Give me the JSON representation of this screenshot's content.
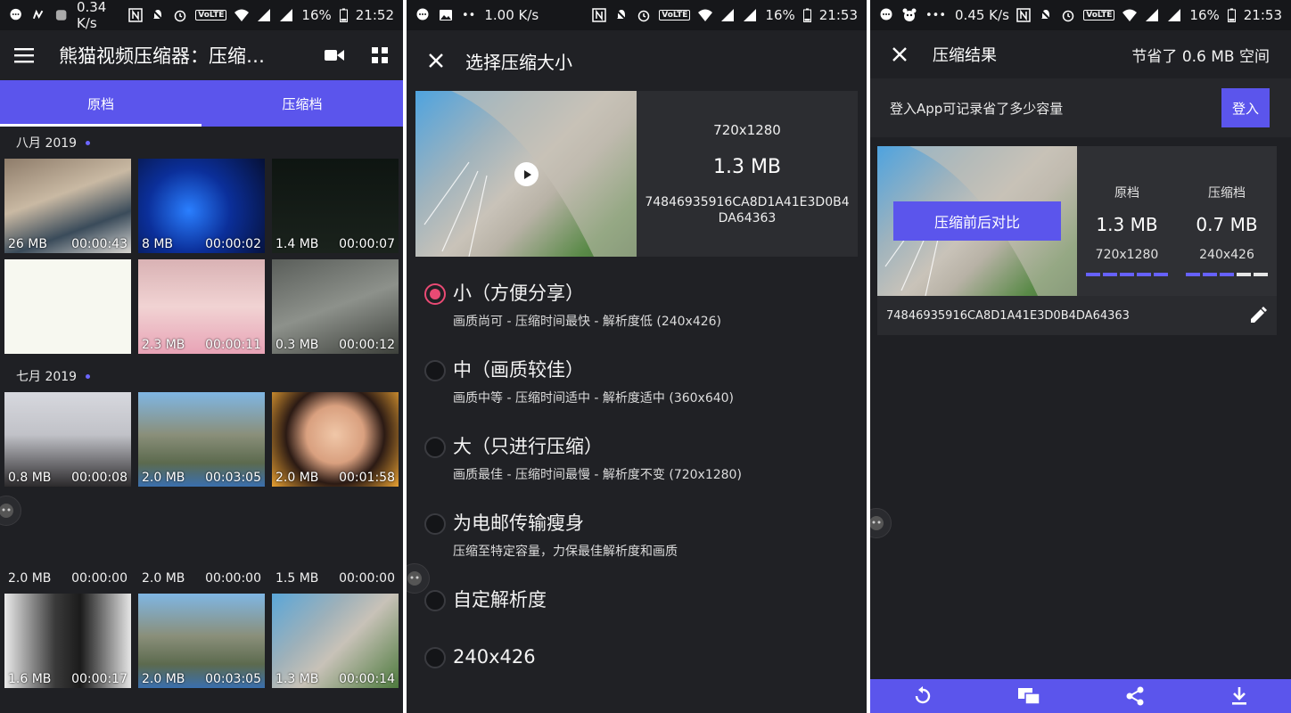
{
  "panel1": {
    "status": {
      "speed": "0.34 K/s",
      "battery": "16%",
      "time": "21:52"
    },
    "app_title": "熊猫视频压缩器：压缩…",
    "tabs": [
      {
        "label": "原档"
      },
      {
        "label": "压缩档"
      }
    ],
    "sections": [
      {
        "header": "八月 2019",
        "items": [
          {
            "size": "26 MB",
            "duration": "00:00:43"
          },
          {
            "size": "8 MB",
            "duration": "00:00:02"
          },
          {
            "size": "1.4 MB",
            "duration": "00:00:07"
          },
          {
            "size": "",
            "duration": ""
          },
          {
            "size": "2.3 MB",
            "duration": "00:00:11"
          },
          {
            "size": "0.3 MB",
            "duration": "00:00:12"
          }
        ]
      },
      {
        "header": "七月 2019",
        "items": [
          {
            "size": "0.8 MB",
            "duration": "00:00:08"
          },
          {
            "size": "2.0 MB",
            "duration": "00:03:05"
          },
          {
            "size": "2.0 MB",
            "duration": "00:01:58"
          },
          {
            "size": "2.0 MB",
            "duration": "00:00:00"
          },
          {
            "size": "2.0 MB",
            "duration": "00:00:00"
          },
          {
            "size": "1.5 MB",
            "duration": "00:00:00"
          },
          {
            "size": "1.6 MB",
            "duration": "00:00:17"
          },
          {
            "size": "2.0 MB",
            "duration": "00:03:05"
          },
          {
            "size": "1.3 MB",
            "duration": "00:00:14"
          }
        ]
      }
    ]
  },
  "panel2": {
    "status": {
      "speed": "1.00 K/s",
      "battery": "16%",
      "time": "21:53"
    },
    "title": "选择压缩大小",
    "preview": {
      "resolution": "720x1280",
      "size": "1.3 MB",
      "hash": "74846935916CA8D1A41E3D0B4DA64363"
    },
    "options": [
      {
        "title": "小（方便分享）",
        "desc": "画质尚可 - 压缩时间最快 - 解析度低 (240x426)",
        "selected": true
      },
      {
        "title": "中（画质较佳）",
        "desc": "画质中等 - 压缩时间适中 - 解析度适中 (360x640)",
        "selected": false
      },
      {
        "title": "大（只进行压缩）",
        "desc": "画质最佳 - 压缩时间最慢 - 解析度不变 (720x1280)",
        "selected": false
      },
      {
        "title": "为电邮传输瘦身",
        "desc": "压缩至特定容量，力保最佳解析度和画质",
        "selected": false
      },
      {
        "title": "自定解析度",
        "desc": "",
        "selected": false
      },
      {
        "title": "240x426",
        "desc": "",
        "selected": false
      }
    ]
  },
  "panel3": {
    "status": {
      "speed": "0.45 K/s",
      "battery": "16%",
      "time": "21:53"
    },
    "title": "压缩结果",
    "saved": "节省了 0.6 MB 空间",
    "login_msg": "登入App可记录省了多少容量",
    "login_button": "登入",
    "compare_button": "压缩前后对比",
    "original": {
      "header": "原档",
      "size": "1.3 MB",
      "resolution": "720x1280",
      "bar_fraction": 1.0
    },
    "compressed": {
      "header": "压缩档",
      "size": "0.7 MB",
      "resolution": "240x426",
      "bar_fraction": 0.6
    },
    "hash": "74846935916CA8D1A41E3D0B4DA64363"
  },
  "colors": {
    "accent": "#5b55ec",
    "radio_selected": "#e94a74",
    "background": "#1f2024"
  }
}
